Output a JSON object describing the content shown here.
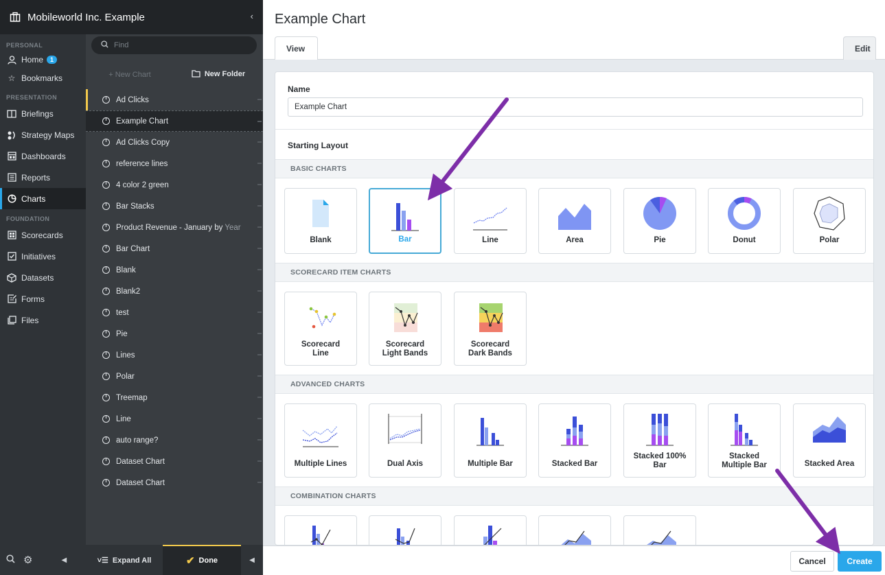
{
  "org": {
    "title": "Mobileworld Inc. Example",
    "collapse_glyph": "‹"
  },
  "nav": {
    "sections": {
      "personal": "PERSONAL",
      "presentation": "PRESENTATION",
      "foundation": "FOUNDATION"
    },
    "items": [
      {
        "label": "Home",
        "icon": "person-icon",
        "badge": "1"
      },
      {
        "label": "Bookmarks",
        "icon": "star-icon"
      },
      {
        "label": "Briefings",
        "icon": "book-icon"
      },
      {
        "label": "Strategy Maps",
        "icon": "strategy-map-icon"
      },
      {
        "label": "Dashboards",
        "icon": "dashboard-icon"
      },
      {
        "label": "Reports",
        "icon": "report-icon"
      },
      {
        "label": "Charts",
        "icon": "chart-pie-icon",
        "active": true
      },
      {
        "label": "Scorecards",
        "icon": "scorecard-icon"
      },
      {
        "label": "Initiatives",
        "icon": "checkbox-icon"
      },
      {
        "label": "Datasets",
        "icon": "cube-icon"
      },
      {
        "label": "Forms",
        "icon": "form-icon"
      },
      {
        "label": "Files",
        "icon": "files-icon"
      }
    ]
  },
  "list": {
    "search_placeholder": "Find",
    "new_chart": "+ New Chart",
    "new_folder": "New Folder",
    "items": [
      "Ad Clicks",
      "Example Chart",
      "Ad Clicks Copy",
      "reference lines",
      "4 color 2 green",
      "Bar Stacks",
      "Product Revenue - January by",
      "Bar Chart",
      "Blank",
      "Blank2",
      "test",
      "Pie",
      "Lines",
      "Polar",
      "Treemap",
      "Line",
      "auto range?",
      "Dataset Chart",
      "Dataset Chart"
    ],
    "item_suffix_dim": "Year",
    "expand_all": "Expand All",
    "done": "Done"
  },
  "main": {
    "title": "Example Chart",
    "tab_view": "View",
    "tab_edit": "Edit",
    "name_label": "Name",
    "name_value": "Example Chart",
    "starting_layout": "Starting Layout",
    "groups": {
      "basic": "BASIC CHARTS",
      "scorecard": "SCORECARD ITEM CHARTS",
      "advanced": "ADVANCED CHARTS",
      "combination": "COMBINATION CHARTS"
    },
    "basic_tiles": [
      "Blank",
      "Bar",
      "Line",
      "Area",
      "Pie",
      "Donut",
      "Polar"
    ],
    "scorecard_tiles": [
      "Scorecard\nLine",
      "Scorecard\nLight Bands",
      "Scorecard\nDark Bands"
    ],
    "advanced_tiles": [
      "Multiple Lines",
      "Dual Axis",
      "Multiple Bar",
      "Stacked Bar",
      "Stacked 100%\nBar",
      "Stacked\nMultiple Bar",
      "Stacked Area"
    ],
    "selected_tile": "Bar",
    "cancel": "Cancel",
    "create": "Create"
  },
  "colors": {
    "accent": "#2aa7ea",
    "bar_blue": "#3b4fd8",
    "bar_light": "#8aa1f0",
    "bar_purple": "#a64df0",
    "annotation_arrow": "#7d2ea8"
  }
}
